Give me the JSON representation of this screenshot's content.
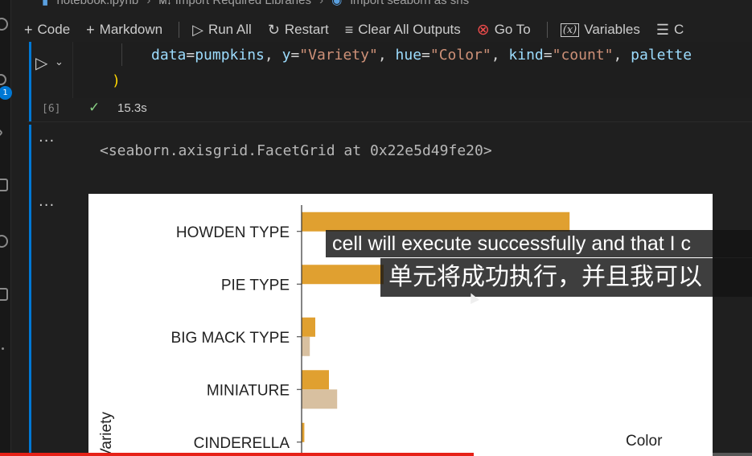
{
  "breadcrumb": {
    "file": "notebook.ipynb",
    "section": "Import Required Libraries",
    "cell": "import seaborn as sns",
    "section_icon": "M↓"
  },
  "activity": {
    "badge": "1"
  },
  "toolbar": {
    "code": "Code",
    "markdown": "Markdown",
    "run_all": "Run All",
    "restart": "Restart",
    "clear_all": "Clear All Outputs",
    "go_to": "Go To",
    "variables": "Variables",
    "outline_partial": "C"
  },
  "cell": {
    "code_line": {
      "p1": "data",
      "o1": "=",
      "v1": "pumpkins",
      "c1": ", ",
      "p2": "y",
      "o2": "=",
      "v2": "\"Variety\"",
      "c2": ", ",
      "p3": "hue",
      "o3": "=",
      "v3": "\"Color\"",
      "c3": ", ",
      "p4": "kind",
      "o4": "=",
      "v4": "\"count\"",
      "c4": ", ",
      "p5": "palette"
    },
    "close_paren": ")",
    "exec_count": "[6]",
    "exec_time": "15.3s"
  },
  "output": {
    "ellipsis": "...",
    "text_repr": "<seaborn.axisgrid.FacetGrid at 0x22e5d49fe20>"
  },
  "chart_data": {
    "type": "bar",
    "orientation": "horizontal",
    "categories": [
      "HOWDEN TYPE",
      "PIE TYPE",
      "BIG MACK TYPE",
      "MINIATURE",
      "CINDERELLA"
    ],
    "series": [
      {
        "values": [
          98,
          30,
          5,
          10,
          1
        ]
      },
      {
        "values": [
          0,
          0,
          3,
          13,
          0
        ]
      }
    ],
    "colors": [
      "#e0a030",
      "#d8c0a0"
    ],
    "ylabel": "Variety",
    "legend_title": "Color",
    "xlim": [
      0,
      100
    ]
  },
  "subtitles": {
    "en": "cell will execute successfully and that I c",
    "zh": "单元将成功执行，并且我可以"
  },
  "video": {
    "progress": 0.63
  }
}
